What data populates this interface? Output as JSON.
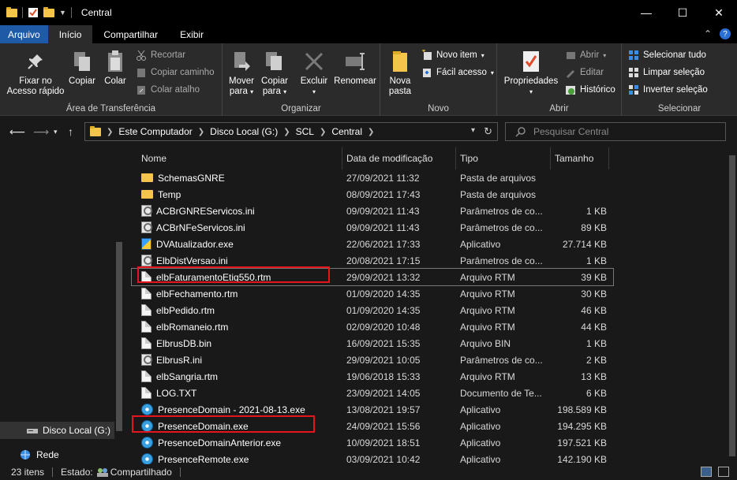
{
  "window": {
    "title": "Central",
    "controls": {
      "minimize": "—",
      "maximize": "☐",
      "close": "✕"
    }
  },
  "ribbon_tabs": [
    {
      "label": "Arquivo"
    },
    {
      "label": "Início"
    },
    {
      "label": "Compartilhar"
    },
    {
      "label": "Exibir"
    }
  ],
  "ribbon": {
    "clipboard": {
      "label": "Área de Transferência",
      "pin": "Fixar no\nAcesso rápido",
      "pin_l1": "Fixar no",
      "pin_l2": "Acesso rápido",
      "copy": "Copiar",
      "paste": "Colar",
      "cut": "Recortar",
      "copy_path": "Copiar caminho",
      "paste_shortcut": "Colar atalho"
    },
    "organize": {
      "label": "Organizar",
      "move_l1": "Mover",
      "move_l2": "para",
      "copy_l1": "Copiar",
      "copy_l2": "para",
      "delete": "Excluir",
      "rename": "Renomear"
    },
    "new": {
      "label": "Novo",
      "new_folder_l1": "Nova",
      "new_folder_l2": "pasta",
      "new_item": "Novo item",
      "easy_access": "Fácil acesso"
    },
    "open": {
      "label": "Abrir",
      "properties": "Propriedades",
      "open": "Abrir",
      "edit": "Editar",
      "history": "Histórico"
    },
    "select": {
      "label": "Selecionar",
      "select_all": "Selecionar tudo",
      "select_none": "Limpar seleção",
      "invert": "Inverter seleção"
    }
  },
  "address": {
    "breadcrumb": [
      "Este Computador",
      "Disco Local (G:)",
      "SCL",
      "Central"
    ],
    "search_placeholder": "Pesquisar Central"
  },
  "nav_pane": {
    "items": [
      {
        "label": "Disco Local (G:)",
        "selected": true
      },
      {
        "label": "Rede",
        "selected": false
      }
    ]
  },
  "file_list": {
    "columns": [
      "Nome",
      "Data de modificação",
      "Tipo",
      "Tamanho"
    ],
    "rows": [
      {
        "name": "SchemasGNRE",
        "date": "27/09/2021 11:32",
        "type": "Pasta de arquivos",
        "size": "",
        "icon": "folder"
      },
      {
        "name": "Temp",
        "date": "08/09/2021 17:43",
        "type": "Pasta de arquivos",
        "size": "",
        "icon": "folder"
      },
      {
        "name": "ACBrGNREServicos.ini",
        "date": "09/09/2021 11:43",
        "type": "Parâmetros de co...",
        "size": "1 KB",
        "icon": "ini"
      },
      {
        "name": "ACBrNFeServicos.ini",
        "date": "09/09/2021 11:43",
        "type": "Parâmetros de co...",
        "size": "89 KB",
        "icon": "ini"
      },
      {
        "name": "DVAtualizador.exe",
        "date": "22/06/2021 17:33",
        "type": "Aplicativo",
        "size": "27.714 KB",
        "icon": "dvexe"
      },
      {
        "name": "ElbDistVersao.ini",
        "date": "20/08/2021 17:15",
        "type": "Parâmetros de co...",
        "size": "1 KB",
        "icon": "ini"
      },
      {
        "name": "elbFaturamentoEtiq550.rtm",
        "date": "29/09/2021 13:32",
        "type": "Arquivo RTM",
        "size": "39 KB",
        "icon": "doc"
      },
      {
        "name": "elbFechamento.rtm",
        "date": "01/09/2020 14:35",
        "type": "Arquivo RTM",
        "size": "30 KB",
        "icon": "doc"
      },
      {
        "name": "elbPedido.rtm",
        "date": "01/09/2020 14:35",
        "type": "Arquivo RTM",
        "size": "46 KB",
        "icon": "doc"
      },
      {
        "name": "elbRomaneio.rtm",
        "date": "02/09/2020 10:48",
        "type": "Arquivo RTM",
        "size": "44 KB",
        "icon": "doc"
      },
      {
        "name": "ElbrusDB.bin",
        "date": "16/09/2021 15:35",
        "type": "Arquivo BIN",
        "size": "1 KB",
        "icon": "doc"
      },
      {
        "name": "ElbrusR.ini",
        "date": "29/09/2021 10:05",
        "type": "Parâmetros de co...",
        "size": "2 KB",
        "icon": "ini"
      },
      {
        "name": "elbSangria.rtm",
        "date": "19/06/2018 15:33",
        "type": "Arquivo RTM",
        "size": "13 KB",
        "icon": "doc"
      },
      {
        "name": "LOG.TXT",
        "date": "23/09/2021 14:05",
        "type": "Documento de Te...",
        "size": "6 KB",
        "icon": "doc"
      },
      {
        "name": "PresenceDomain - 2021-08-13.exe",
        "date": "13/08/2021 19:57",
        "type": "Aplicativo",
        "size": "198.589 KB",
        "icon": "exe"
      },
      {
        "name": "PresenceDomain.exe",
        "date": "24/09/2021 15:56",
        "type": "Aplicativo",
        "size": "194.295 KB",
        "icon": "exe"
      },
      {
        "name": "PresenceDomainAnterior.exe",
        "date": "10/09/2021 18:51",
        "type": "Aplicativo",
        "size": "197.521 KB",
        "icon": "exe"
      },
      {
        "name": "PresenceRemote.exe",
        "date": "03/09/2021 10:42",
        "type": "Aplicativo",
        "size": "142.190 KB",
        "icon": "exe"
      }
    ]
  },
  "status": {
    "count": "23 itens",
    "state": "Estado:",
    "shared": "Compartilhado"
  },
  "colors": {
    "file_tab": "#1f5aa6",
    "highlight": "#e5141d",
    "folder": "#f4c54a"
  }
}
